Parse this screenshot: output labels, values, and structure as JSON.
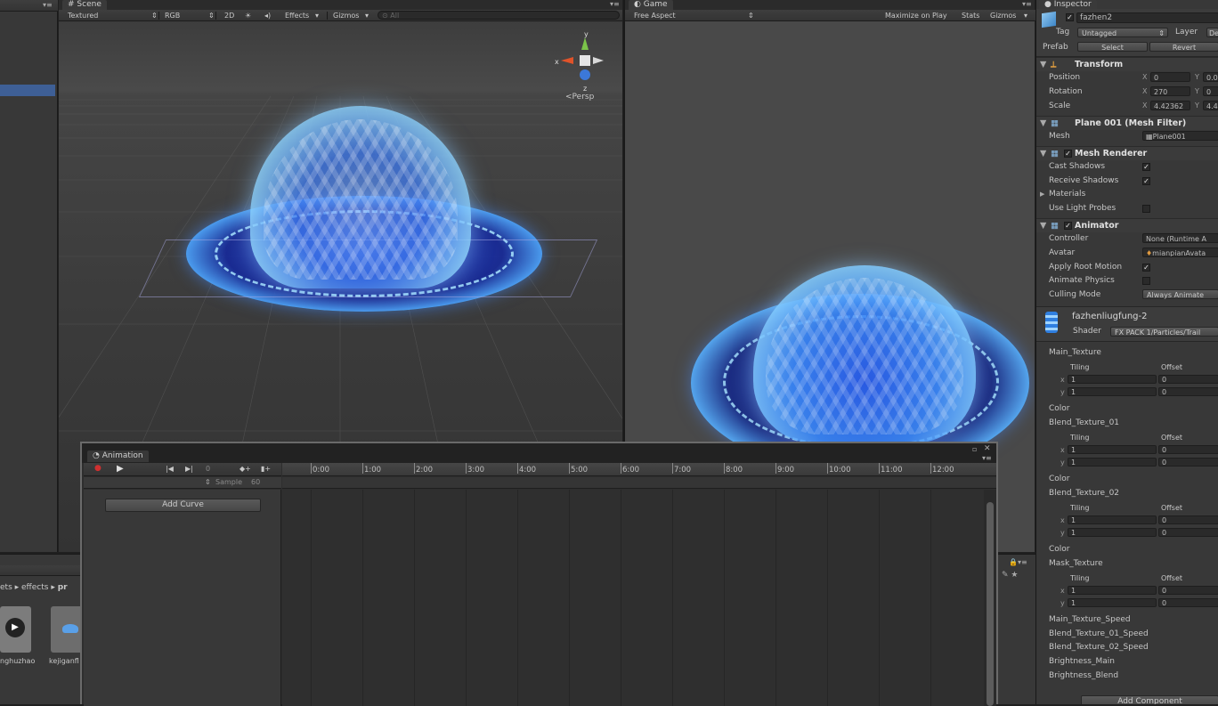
{
  "scene": {
    "tab": "Scene",
    "shading": "Textured",
    "render_mode": "RGB",
    "mode_2d": "2D",
    "effects": "Effects",
    "gizmos": "Gizmos",
    "search_placeholder": "All",
    "persp": "Persp",
    "axis_y": "y",
    "axis_x": "x",
    "axis_z": "z"
  },
  "game": {
    "tab": "Game",
    "aspect": "Free Aspect",
    "maximize": "Maximize on Play",
    "stats": "Stats",
    "gizmos": "Gizmos"
  },
  "project": {
    "breadcrumb": [
      "ets",
      "effects",
      "pr"
    ],
    "assets": [
      {
        "name": "nghuzhao"
      },
      {
        "name": "kejiganfl"
      }
    ]
  },
  "animation": {
    "tab": "Animation",
    "frame": "0",
    "sample_label": "Sample",
    "sample_value": "60",
    "add_curve": "Add Curve",
    "timeline": [
      "0:00",
      "1:00",
      "2:00",
      "3:00",
      "4:00",
      "5:00",
      "6:00",
      "7:00",
      "8:00",
      "9:00",
      "10:00",
      "11:00",
      "12:00"
    ]
  },
  "inspector": {
    "tab": "Inspector",
    "object_name": "fazhen2",
    "tag_label": "Tag",
    "tag_value": "Untagged",
    "layer_label": "Layer",
    "layer_value": "De",
    "prefab_label": "Prefab",
    "select": "Select",
    "revert": "Revert",
    "transform": {
      "title": "Transform",
      "position": "Position",
      "rotation": "Rotation",
      "scale": "Scale",
      "pos_x": "0",
      "pos_y": "0.0",
      "rot_x": "270",
      "rot_y": "0",
      "scale_x": "4.42362",
      "scale_y": "4.4",
      "x": "X",
      "y": "Y"
    },
    "mesh_filter": {
      "title": "Plane 001 (Mesh Filter)",
      "mesh_label": "Mesh",
      "mesh_value": "Plane001"
    },
    "mesh_renderer": {
      "title": "Mesh Renderer",
      "cast_shadows": "Cast Shadows",
      "receive_shadows": "Receive Shadows",
      "materials": "Materials",
      "use_light_probes": "Use Light Probes"
    },
    "animator": {
      "title": "Animator",
      "controller": "Controller",
      "controller_value": "None (Runtime A",
      "avatar": "Avatar",
      "avatar_value": "mianpianAvata",
      "apply_root_motion": "Apply Root Motion",
      "animate_physics": "Animate Physics",
      "culling_mode": "Culling Mode",
      "culling_value": "Always Animate"
    },
    "material": {
      "name": "fazhenliugfung-2",
      "shader_label": "Shader",
      "shader_value": "FX PACK 1/Particles/Trail",
      "tiling": "Tiling",
      "offset": "Offset",
      "color": "Color",
      "textures": [
        "Main_Texture",
        "Blend_Texture_01",
        "Blend_Texture_02",
        "Mask_Texture"
      ],
      "tile_x": "1",
      "tile_y": "1",
      "off_x": "0",
      "off_y": "0",
      "x": "x",
      "y": "y",
      "speeds": [
        "Main_Texture_Speed",
        "Blend_Texture_01_Speed",
        "Blend_Texture_02_Speed",
        "Brightness_Main",
        "Brightness_Blend"
      ]
    },
    "add_component": "Add Component"
  }
}
